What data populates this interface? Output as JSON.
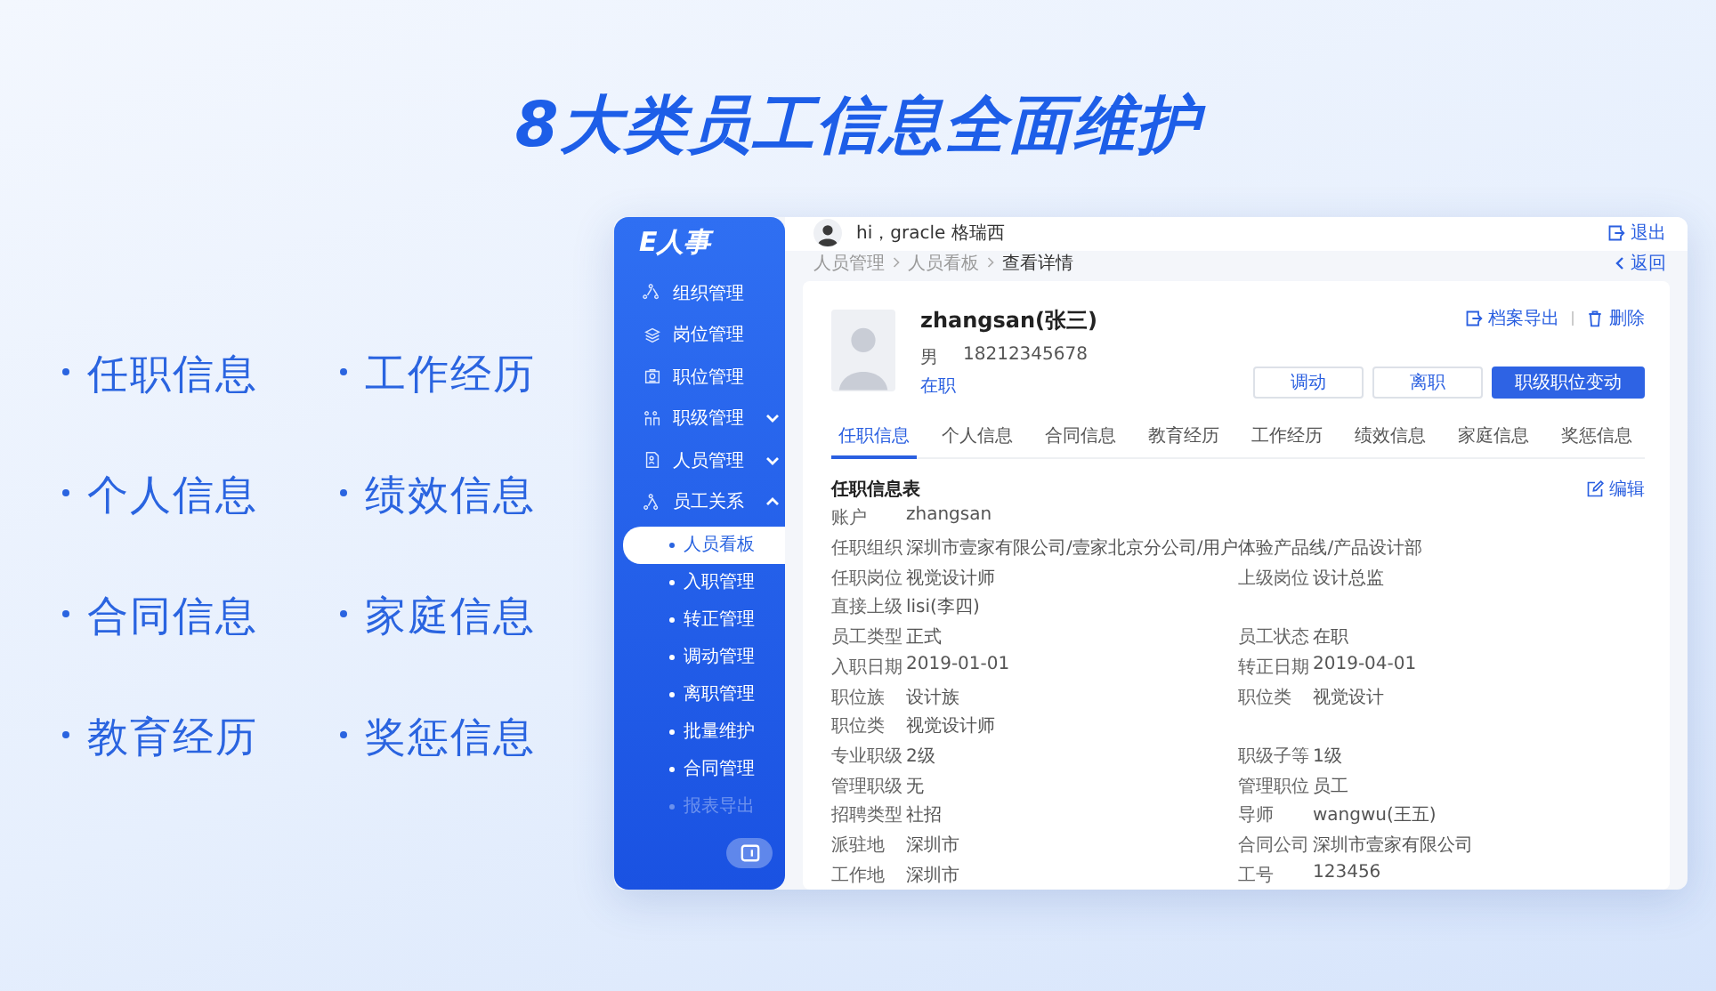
{
  "headline": "8大类员工信息全面维护",
  "features": [
    "任职信息",
    "工作经历",
    "个人信息",
    "绩效信息",
    "合同信息",
    "家庭信息",
    "教育经历",
    "奖惩信息"
  ],
  "sidebar": {
    "logo": "E人事",
    "items": [
      {
        "label": "组织管理"
      },
      {
        "label": "岗位管理"
      },
      {
        "label": "职位管理"
      },
      {
        "label": "职级管理",
        "expanded": false
      },
      {
        "label": "人员管理",
        "expanded": false
      },
      {
        "label": "员工关系",
        "expanded": true,
        "children": [
          {
            "label": "人员看板",
            "selected": true
          },
          {
            "label": "入职管理",
            "selected": false
          },
          {
            "label": "转正管理",
            "selected": false
          },
          {
            "label": "调动管理",
            "selected": false
          },
          {
            "label": "离职管理",
            "selected": false
          },
          {
            "label": "批量维护",
            "selected": false
          },
          {
            "label": "合同管理",
            "selected": false
          },
          {
            "label": "报表导出",
            "selected": false
          }
        ]
      }
    ]
  },
  "header": {
    "greeting": "hi，gracle 格瑞西",
    "logout": "退出"
  },
  "breadcrumb": [
    "人员管理",
    "人员看板",
    "查看详情"
  ],
  "back": "返回",
  "profile": {
    "name": "zhangsan(张三)",
    "gender": "男",
    "phone": "18212345678",
    "status": "在职"
  },
  "actions": [
    "档案导出",
    "删除"
  ],
  "buttons": [
    {
      "label": "调动",
      "kind": "default"
    },
    {
      "label": "离职",
      "kind": "default"
    },
    {
      "label": "职级职位变动",
      "kind": "primary"
    }
  ],
  "tabs": [
    {
      "label": "任职信息",
      "selected": true
    },
    {
      "label": "个人信息",
      "selected": false
    },
    {
      "label": "合同信息",
      "selected": false
    },
    {
      "label": "教育经历",
      "selected": false
    },
    {
      "label": "工作经历",
      "selected": false
    },
    {
      "label": "绩效信息",
      "selected": false
    },
    {
      "label": "家庭信息",
      "selected": false
    },
    {
      "label": "奖惩信息",
      "selected": false
    }
  ],
  "section": {
    "title": "任职信息表",
    "edit": "编辑",
    "rows": [
      [
        {
          "label": "账户",
          "value": "zhangsan"
        }
      ],
      [
        {
          "label": "任职组织",
          "value": "深圳市壹家有限公司/壹家北京分公司/用户体验产品线/产品设计部"
        }
      ],
      [
        {
          "label": "任职岗位",
          "value": "视觉设计师"
        },
        {
          "label": "上级岗位",
          "value": "设计总监"
        }
      ],
      [
        {
          "label": "直接上级",
          "value": "lisi(李四)"
        }
      ],
      [
        {
          "label": "员工类型",
          "value": "正式"
        },
        {
          "label": "员工状态",
          "value": "在职"
        }
      ],
      [
        {
          "label": "入职日期",
          "value": "2019-01-01"
        },
        {
          "label": "转正日期",
          "value": "2019-04-01"
        }
      ],
      [
        {
          "label": "职位族",
          "value": "设计族"
        },
        {
          "label": "职位类",
          "value": "视觉设计"
        }
      ],
      [
        {
          "label": "职位类",
          "value": "视觉设计师"
        }
      ],
      [
        {
          "label": "专业职级",
          "value": "2级"
        },
        {
          "label": "职级子等",
          "value": "1级"
        }
      ],
      [
        {
          "label": "管理职级",
          "value": "无"
        },
        {
          "label": "管理职位",
          "value": "员工"
        }
      ],
      [
        {
          "label": "招聘类型",
          "value": "社招"
        },
        {
          "label": "导师",
          "value": "wangwu(王五)"
        }
      ],
      [
        {
          "label": "派驻地",
          "value": "深圳市"
        },
        {
          "label": "合同公司",
          "value": "深圳市壹家有限公司"
        }
      ],
      [
        {
          "label": "工作地",
          "value": "深圳市"
        },
        {
          "label": "工号",
          "value": "123456"
        }
      ]
    ]
  }
}
